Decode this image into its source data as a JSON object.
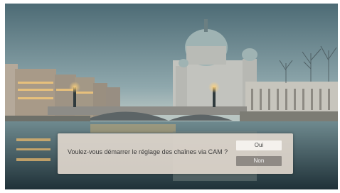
{
  "dialog": {
    "message": "Voulez-vous démarrer le réglage des chaînes via CAM ?",
    "yes_label": "Oui",
    "no_label": "Non",
    "selected": "Non"
  },
  "background": {
    "scene": "river-city-dusk-wallpaper"
  }
}
